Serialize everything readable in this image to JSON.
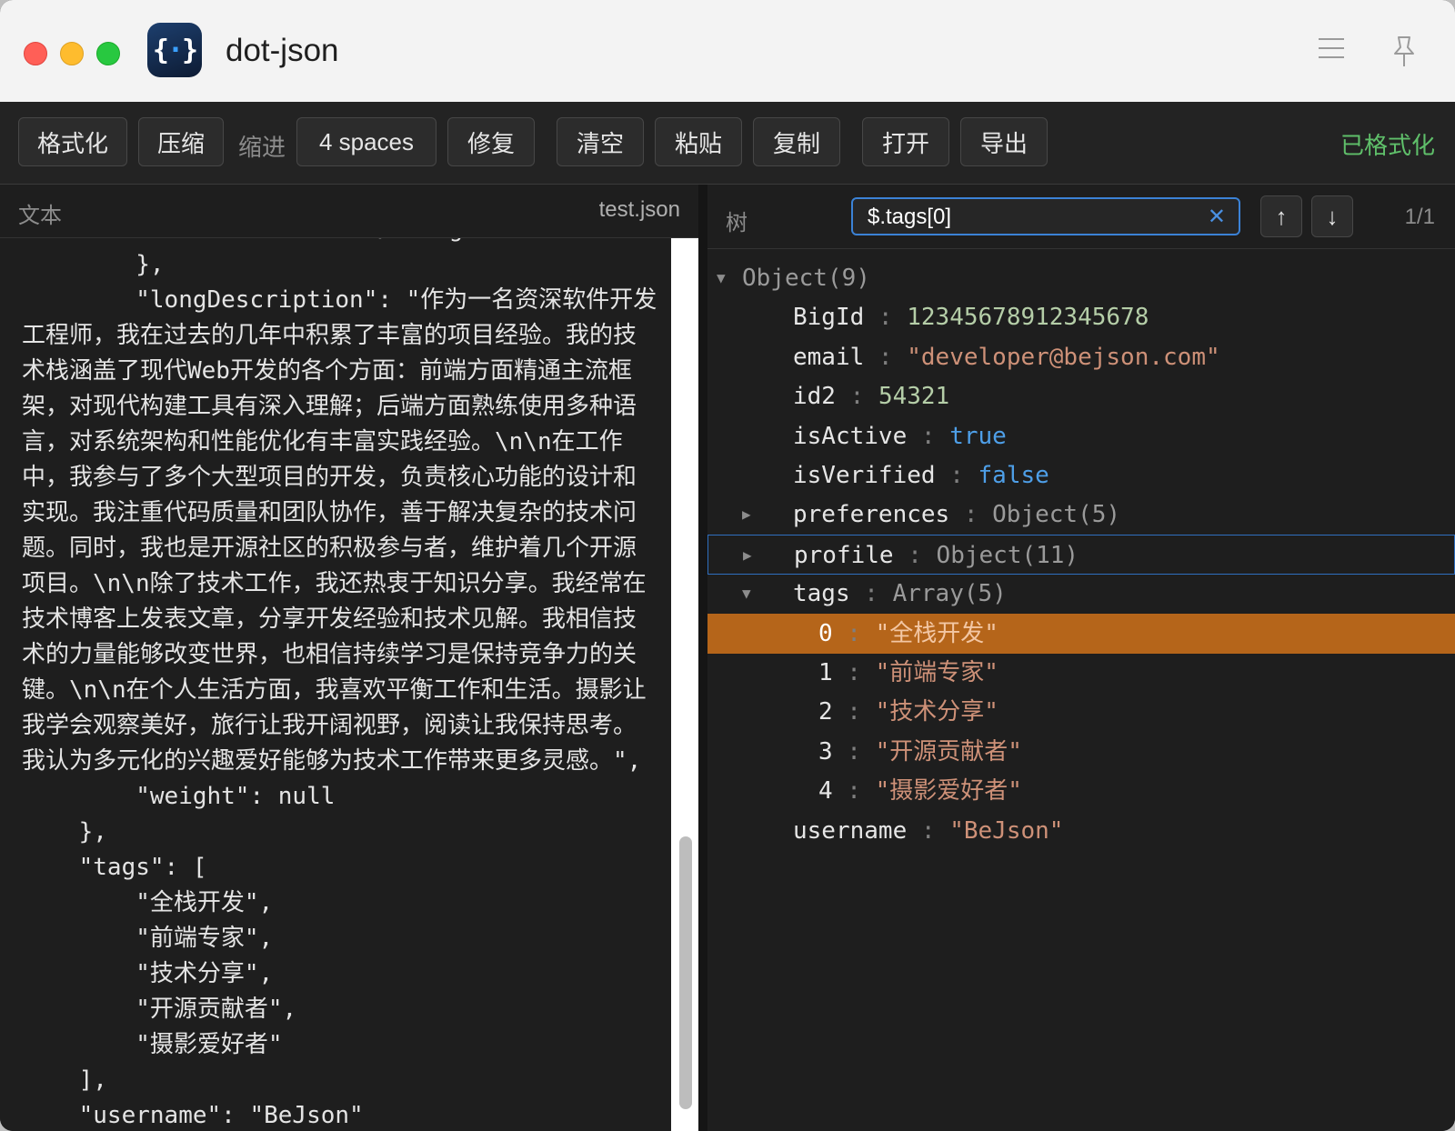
{
  "window": {
    "title": "dot-json",
    "app_icon_glyph": "{·}",
    "menu_icon": "hamburger-menu-icon",
    "pin_icon": "pin-icon"
  },
  "toolbar": {
    "format_label": "格式化",
    "compress_label": "压缩",
    "indent_label": "缩进",
    "indent_value": "4 spaces",
    "repair_label": "修复",
    "clear_label": "清空",
    "paste_label": "粘贴",
    "copy_label": "复制",
    "open_label": "打开",
    "export_label": "导出",
    "status": "已格式化",
    "status_color": "#5fbf6a"
  },
  "left_panel": {
    "title": "文本",
    "filename": "test.json",
    "code_lines": [
      "        \"timezone\": \"Asia/Shanghai\"",
      "        },",
      "        \"longDescription\": \"作为一名资深软件开发工程师，我在过去的几年中积累了丰富的项目经验。我的技术栈涵盖了现代Web开发的各个方面：前端方面精通主流框架，对现代构建工具有深入理解；后端方面熟练使用多种语言，对系统架构和性能优化有丰富实践经验。\\n\\n在工作中，我参与了多个大型项目的开发，负责核心功能的设计和实现。我注重代码质量和团队协作，善于解决复杂的技术问题。同时，我也是开源社区的积极参与者，维护着几个开源项目。\\n\\n除了技术工作，我还热衷于知识分享。我经常在技术博客上发表文章，分享开发经验和技术见解。我相信技术的力量能够改变世界，也相信持续学习是保持竞争力的关键。\\n\\n在个人生活方面，我喜欢平衡工作和生活。摄影让我学会观察美好，旅行让我开阔视野，阅读让我保持思考。我认为多元化的兴趣爱好能够为技术工作带来更多灵感。\",",
      "        \"weight\": null",
      "    },",
      "    \"tags\": [",
      "        \"全栈开发\",",
      "        \"前端专家\",",
      "        \"技术分享\",",
      "        \"开源贡献者\",",
      "        \"摄影爱好者\"",
      "    ],",
      "    \"username\": \"BeJson\""
    ]
  },
  "right_panel": {
    "title": "树",
    "search_value": "$.tags[0]",
    "clear_icon": "close-icon",
    "prev_label": "↑",
    "next_label": "↓",
    "match_count": "1/1",
    "tree": [
      {
        "arrow": "▼",
        "key": "Object(9)",
        "value": "",
        "type": "root"
      },
      {
        "arrow": "",
        "key": "BigId",
        "value": "12345678912345678",
        "type": "num"
      },
      {
        "arrow": "",
        "key": "email",
        "value": "\"developer@bejson.com\"",
        "type": "str"
      },
      {
        "arrow": "",
        "key": "id2",
        "value": "54321",
        "type": "num"
      },
      {
        "arrow": "",
        "key": "isActive",
        "value": "true",
        "type": "bool"
      },
      {
        "arrow": "",
        "key": "isVerified",
        "value": "false",
        "type": "bool"
      },
      {
        "arrow": "▶",
        "key": "preferences",
        "value": "Object(5)",
        "type": "meta"
      },
      {
        "arrow": "▶",
        "key": "profile",
        "value": "Object(11)",
        "type": "meta"
      },
      {
        "arrow": "▼",
        "key": "tags",
        "value": "Array(5)",
        "type": "meta"
      },
      {
        "arrow": "",
        "key": "0",
        "value": "\"全栈开发\"",
        "type": "str"
      },
      {
        "arrow": "",
        "key": "1",
        "value": "\"前端专家\"",
        "type": "str"
      },
      {
        "arrow": "",
        "key": "2",
        "value": "\"技术分享\"",
        "type": "str"
      },
      {
        "arrow": "",
        "key": "3",
        "value": "\"开源贡献者\"",
        "type": "str"
      },
      {
        "arrow": "",
        "key": "4",
        "value": "\"摄影爱好者\"",
        "type": "str"
      },
      {
        "arrow": "",
        "key": "username",
        "value": "\"BeJson\"",
        "type": "str"
      }
    ],
    "selected_row": 9,
    "focused_row": 7,
    "selected_color": "#b5651a"
  }
}
